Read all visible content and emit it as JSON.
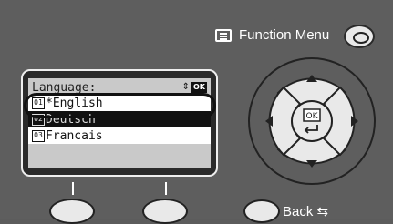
{
  "function_menu": {
    "label": "Function Menu"
  },
  "lcd": {
    "header_text": "Language:",
    "header_ok": "OK",
    "header_arrows": "⇕",
    "items": [
      {
        "num": "01",
        "text": "*English"
      },
      {
        "num": "02",
        "text": "Deutsch"
      },
      {
        "num": "03",
        "text": "Francais"
      }
    ]
  },
  "dpad": {
    "center_label": "OK"
  },
  "back": {
    "label": "Back ⇆"
  },
  "colors": {
    "panel": "#5e5e5e",
    "button": "#e9e9e9",
    "lcd_bg": "#c9c9c9",
    "selected_row": "#111111"
  }
}
